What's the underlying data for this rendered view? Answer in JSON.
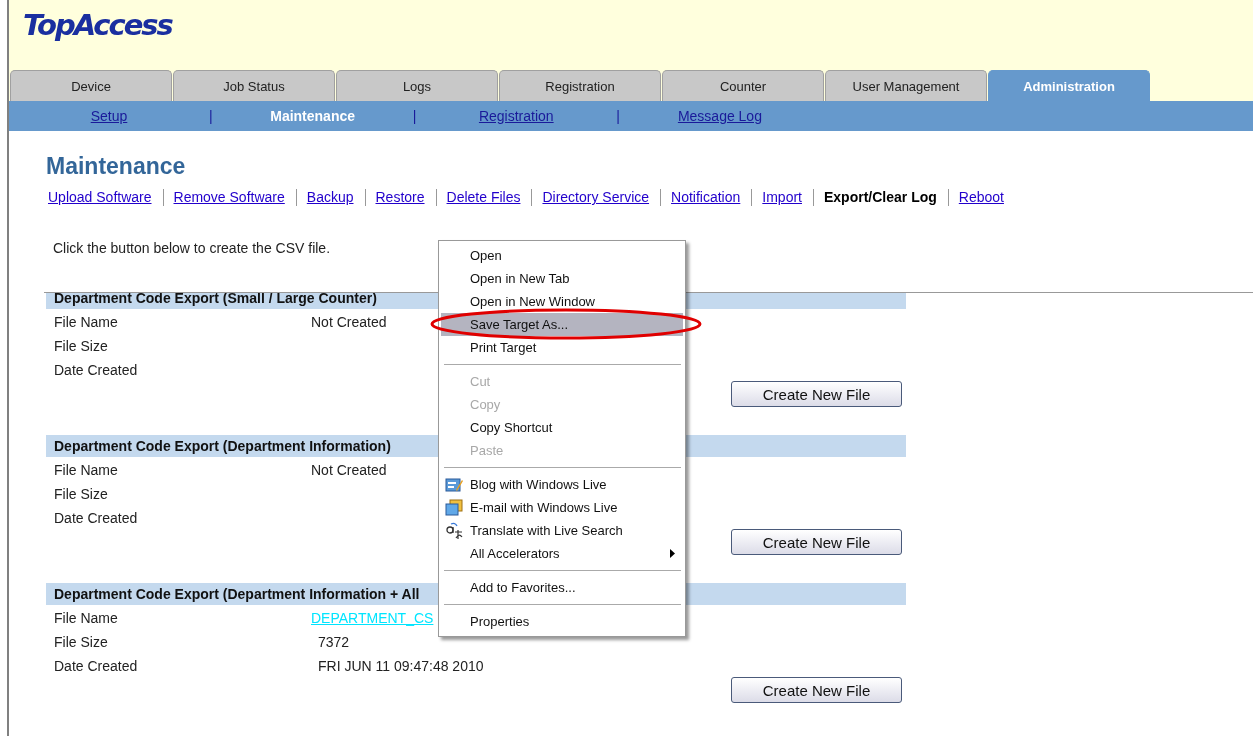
{
  "header": {
    "logo": "TopAccess"
  },
  "tabs": [
    {
      "label": "Device",
      "selected": false
    },
    {
      "label": "Job Status",
      "selected": false
    },
    {
      "label": "Logs",
      "selected": false
    },
    {
      "label": "Registration",
      "selected": false
    },
    {
      "label": "Counter",
      "selected": false
    },
    {
      "label": "User Management",
      "selected": false
    },
    {
      "label": "Administration",
      "selected": true
    }
  ],
  "subnav": [
    {
      "kind": "link",
      "label": "Setup",
      "selected": false
    },
    {
      "kind": "separator",
      "label": "|"
    },
    {
      "kind": "link",
      "label": "Maintenance",
      "selected": true
    },
    {
      "kind": "separator",
      "label": "|"
    },
    {
      "kind": "link",
      "label": "Registration",
      "selected": false
    },
    {
      "kind": "separator",
      "label": "|"
    },
    {
      "kind": "link",
      "label": "Message Log",
      "selected": false
    }
  ],
  "page_title": "Maintenance",
  "links": [
    {
      "label": "Upload Software",
      "selected": false
    },
    {
      "label": "Remove Software",
      "selected": false
    },
    {
      "label": "Backup",
      "selected": false
    },
    {
      "label": "Restore",
      "selected": false
    },
    {
      "label": "Delete Files",
      "selected": false
    },
    {
      "label": "Directory Service",
      "selected": false
    },
    {
      "label": "Notification",
      "selected": false
    },
    {
      "label": "Import",
      "selected": false
    },
    {
      "label": "Export/Clear Log",
      "selected": true
    },
    {
      "label": "Reboot",
      "selected": false
    }
  ],
  "instruction": "Click the button below to create the CSV file.",
  "sections": [
    {
      "title": "Department Code Export (Small / Large Counter)",
      "rows": [
        {
          "label": "File Name",
          "value": "Not Created",
          "kind": "text"
        },
        {
          "label": "File Size"
        },
        {
          "label": "Date Created"
        }
      ],
      "button": "Create New File"
    },
    {
      "title": "Department Code Export (Department Information)",
      "rows": [
        {
          "label": "File Name",
          "value": "Not Created",
          "kind": "text"
        },
        {
          "label": "File Size"
        },
        {
          "label": "Date Created"
        }
      ],
      "button": "Create New File"
    },
    {
      "title": "Department Code Export (Department Information + All",
      "rows": [
        {
          "label": "File Name",
          "value": "DEPARTMENT_CS",
          "kind": "link"
        },
        {
          "label": "File Size",
          "value": "7372",
          "kind": "text"
        },
        {
          "label": "Date Created",
          "value": "FRI JUN 11 09:47:48 2010",
          "kind": "text"
        }
      ],
      "button": "Create New File"
    }
  ],
  "context_menu": [
    {
      "kind": "item",
      "label": "Open",
      "disabled": false,
      "selected": false
    },
    {
      "kind": "item",
      "label": "Open in New Tab",
      "disabled": false,
      "selected": false
    },
    {
      "kind": "item",
      "label": "Open in New Window",
      "disabled": false,
      "selected": false
    },
    {
      "kind": "item",
      "label": "Save Target As...",
      "disabled": false,
      "selected": true
    },
    {
      "kind": "item",
      "label": "Print Target",
      "disabled": false,
      "selected": false
    },
    {
      "kind": "separator"
    },
    {
      "kind": "item",
      "label": "Cut",
      "disabled": true,
      "selected": false
    },
    {
      "kind": "item",
      "label": "Copy",
      "disabled": true,
      "selected": false
    },
    {
      "kind": "item",
      "label": "Copy Shortcut",
      "disabled": false,
      "selected": false
    },
    {
      "kind": "item",
      "label": "Paste",
      "disabled": true,
      "selected": false
    },
    {
      "kind": "separator"
    },
    {
      "kind": "item",
      "label": "Blog with Windows Live",
      "disabled": false,
      "selected": false,
      "icon": true
    },
    {
      "kind": "item",
      "label": "E-mail with Windows Live",
      "disabled": false,
      "selected": false,
      "icon": true
    },
    {
      "kind": "item",
      "label": "Translate with Live Search",
      "disabled": false,
      "selected": false,
      "icon": true
    },
    {
      "kind": "submenu",
      "label": "All Accelerators",
      "disabled": false,
      "selected": false
    },
    {
      "kind": "separator"
    },
    {
      "kind": "item",
      "label": "Add to Favorites...",
      "disabled": false,
      "selected": false
    },
    {
      "kind": "separator"
    },
    {
      "kind": "item",
      "label": "Properties",
      "disabled": false,
      "selected": false
    }
  ]
}
